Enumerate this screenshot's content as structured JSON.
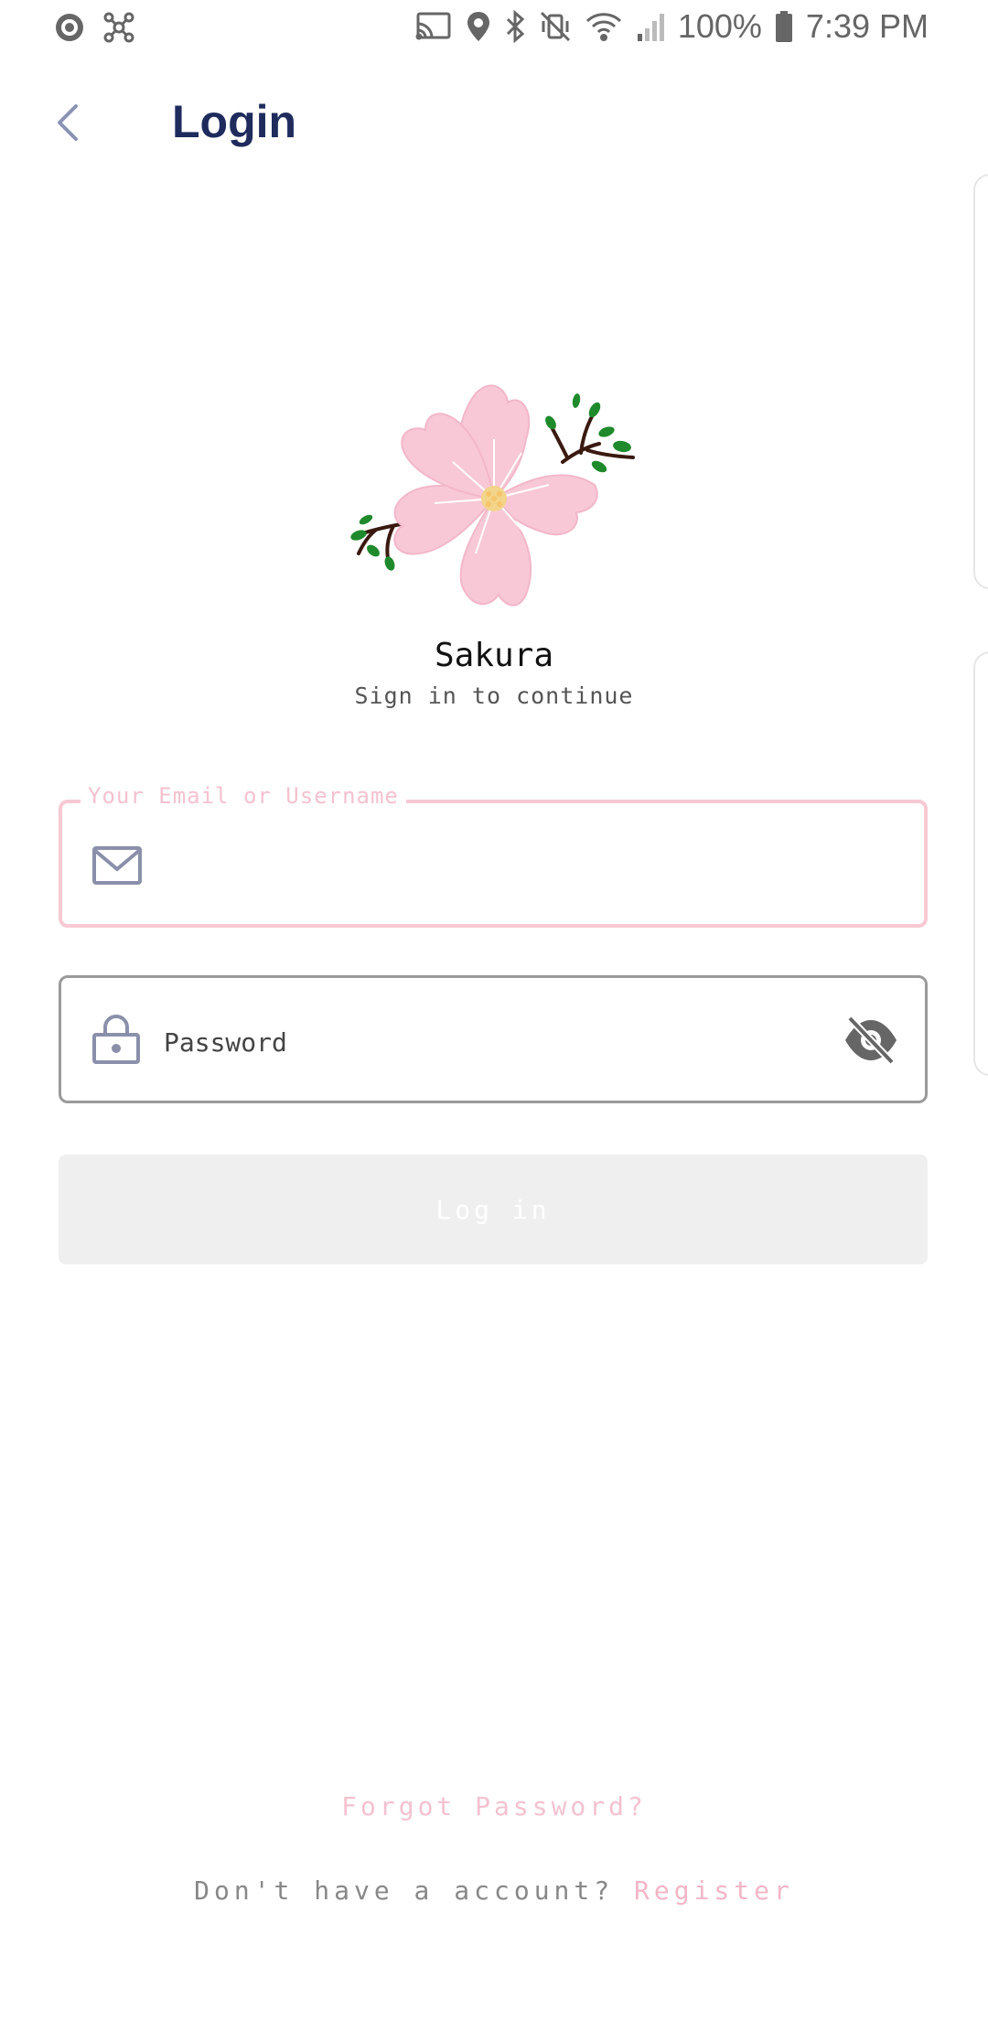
{
  "status_bar": {
    "battery_percent": "100%",
    "time": "7:39 PM",
    "icons": [
      "o-circle-icon",
      "network-icon",
      "cast-icon",
      "location-icon",
      "bluetooth-icon",
      "vibrate-mute-icon",
      "wifi-icon",
      "signal-icon",
      "battery-icon"
    ]
  },
  "header": {
    "title": "Login",
    "back_icon": "chevron-left-icon"
  },
  "brand": {
    "name": "Sakura",
    "subtitle": "Sign in to continue",
    "logo_icon": "sakura-blossom-logo"
  },
  "form": {
    "email": {
      "label": "Your Email or Username",
      "value": "",
      "icon": "mail-icon"
    },
    "password": {
      "placeholder": "Password",
      "value": "",
      "icon": "lock-icon",
      "toggle_icon": "eye-off-icon"
    },
    "login_button": "Log in"
  },
  "footer": {
    "forgot_password": "Forgot Password?",
    "no_account": "Don't have a account?",
    "register": "Register"
  },
  "colors": {
    "accent_pink": "#f4c2cf",
    "title_navy": "#1e2b5c",
    "disabled_button": "#efefef"
  }
}
